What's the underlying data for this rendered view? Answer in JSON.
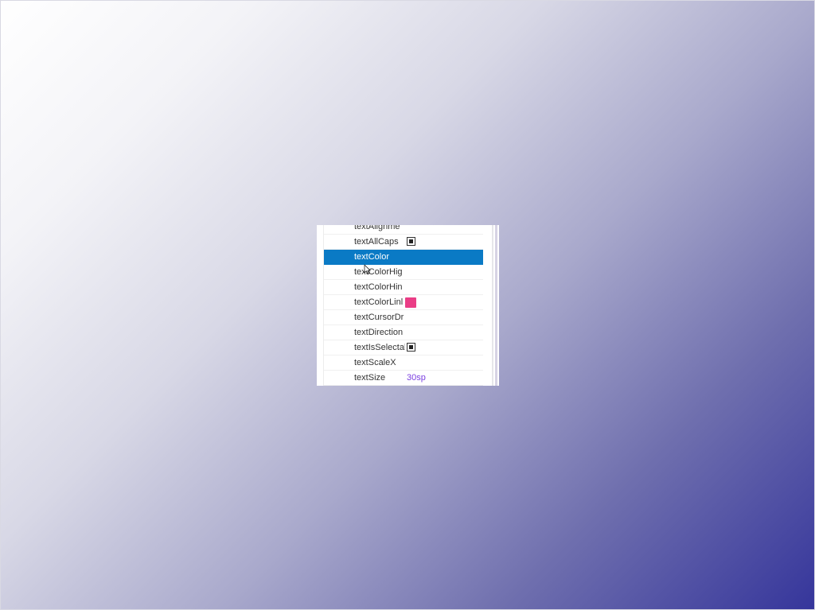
{
  "properties": [
    {
      "name": "textAlignme",
      "value": "",
      "control": "none"
    },
    {
      "name": "textAllCaps",
      "value": "",
      "control": "checkbox"
    },
    {
      "name": "textColor",
      "value": "",
      "control": "none",
      "selected": true
    },
    {
      "name": "textColorHig",
      "value": "",
      "control": "none"
    },
    {
      "name": "textColorHin",
      "value": "",
      "control": "none"
    },
    {
      "name": "textColorLinl",
      "value": "",
      "control": "swatch",
      "swatch_color": "#ea3d86"
    },
    {
      "name": "textCursorDr",
      "value": "",
      "control": "none"
    },
    {
      "name": "textDirection",
      "value": "",
      "control": "none"
    },
    {
      "name": "textIsSelectal",
      "value": "",
      "control": "checkbox"
    },
    {
      "name": "textScaleX",
      "value": "",
      "control": "none"
    },
    {
      "name": "textSize",
      "value": "30sp",
      "control": "text"
    }
  ],
  "colors": {
    "selection": "#0a7ac5",
    "value_text": "#7b3fe0",
    "link_swatch": "#ea3d86"
  },
  "icons": {
    "cursor": "mouse-pointer-icon"
  }
}
